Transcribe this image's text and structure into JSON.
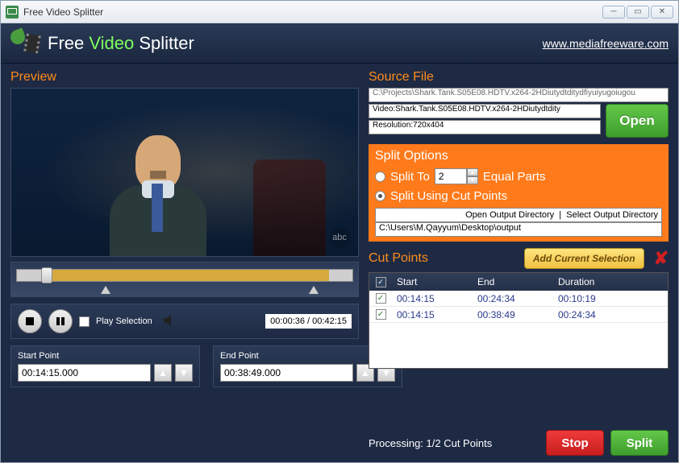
{
  "window": {
    "title": "Free Video Splitter"
  },
  "header": {
    "brand_pre": "Free ",
    "brand_mid": "Video",
    "brand_post": " Splitter",
    "link": "www.mediafreeware.com"
  },
  "preview": {
    "label": "Preview",
    "broadcast_logo": "abc"
  },
  "playback": {
    "play_selection_label": "Play Selection",
    "time_current": "00:00:36",
    "time_total": "00:42:15"
  },
  "points": {
    "start_label": "Start Point",
    "start_value": "00:14:15.000",
    "end_label": "End Point",
    "end_value": "00:38:49.000"
  },
  "source": {
    "label": "Source File",
    "path": "C:\\Projects\\Shark.Tank.S05E08.HDTV.x264-2HDiutydtditydfiyuiyugoiugou",
    "video": "Video:Shark.Tank.S05E08.HDTV.x264-2HDiutydtdity",
    "resolution": "Resolution:720x404",
    "open_btn": "Open"
  },
  "split": {
    "label": "Split Options",
    "split_to_pre": "Split To",
    "split_to_val": "2",
    "split_to_post": "Equal Parts",
    "split_using_label": "Split Using Cut Points",
    "open_out": "Open Output Directory",
    "select_out": "Select Output Directory",
    "out_path": "C:\\Users\\M.Qayyum\\Desktop\\output"
  },
  "cuts": {
    "label": "Cut Points",
    "add_btn": "Add Current Selection",
    "headers": {
      "start": "Start",
      "end": "End",
      "dur": "Duration"
    },
    "rows": [
      {
        "start": "00:14:15",
        "end": "00:24:34",
        "dur": "00:10:19",
        "checked": true
      },
      {
        "start": "00:14:15",
        "end": "00:38:49",
        "dur": "00:24:34",
        "checked": true
      }
    ]
  },
  "footer": {
    "processing": "Processing: 1/2 Cut Points",
    "stop": "Stop",
    "split": "Split"
  }
}
